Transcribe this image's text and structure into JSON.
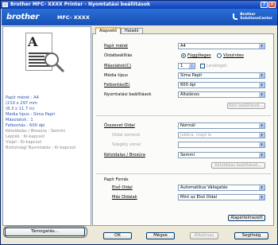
{
  "window": {
    "title": "Brother MFC- XXXX  Printer - Nyomtatási beállítások"
  },
  "header": {
    "brand": "brother",
    "model": "MFC- XXXX",
    "solutions_line1": "Brother",
    "solutions_line2": "SolutionsCenter"
  },
  "tabs": [
    {
      "label": "Alapvető"
    },
    {
      "label": "Haladó"
    }
  ],
  "preview": {
    "info": [
      "Papír méret : A4",
      "(210 x 297 mm",
      "(8.3 x 11.7 in)",
      "Média típus : Sima Papír",
      "Másolatok : 1",
      "Felbontás : 600 dpi",
      "Kétoldalas / Brosúra : Semmi",
      "Lépték : Ki-kapcsol",
      "Vízjel : Ki-kapcsol",
      "Biztonsági Nyomtatás : Ki-kapcsol"
    ]
  },
  "form": {
    "paper_size": {
      "label": "Papír méret",
      "value": "A4"
    },
    "orientation": {
      "label": "Oldalbeállítás",
      "portrait": "Függőleges",
      "landscape": "Vízszintes"
    },
    "copies": {
      "label": "Másolatok(C)",
      "value": "1",
      "collate": "Leválogat"
    },
    "media_type": {
      "label": "Média típus",
      "value": "Sima Papír"
    },
    "resolution": {
      "label": "Felbontás(E)",
      "value": "600 dpi"
    },
    "print_settings": {
      "label": "Nyomtatási beállítások",
      "value": "Általános",
      "manual_btn": "Kézi beállítások..."
    },
    "multiple_page": {
      "label": "Összevet Oldal",
      "value": "Normál"
    },
    "page_order": {
      "label": "Oldal sorrend",
      "value": "Jobbra, majd le"
    },
    "border_line": {
      "label": "Szegély vonal",
      "value": ""
    },
    "duplex": {
      "label": "Kétoldalas / Brosúra",
      "value": "Semmi",
      "settings_btn": "Kétoldalas beállítások..."
    },
    "paper_source": {
      "group": "Papír Forrás",
      "first_page": {
        "label": "Első Oldal",
        "value": "Automatikus Válogatás"
      },
      "other_pages": {
        "label": "Más Oldalak",
        "value": "Mint az Első Oldal"
      }
    },
    "default_btn": "Alapértelmezett"
  },
  "bottom": {
    "support": "Támogatás...",
    "ok": "OK",
    "cancel": "Mégse",
    "apply": "Alkalmaz",
    "help": "Segítség"
  },
  "colors": {
    "title_bar": "#0a3fb8",
    "header": "#1f5fc8",
    "info_text": "#2c55b0"
  }
}
